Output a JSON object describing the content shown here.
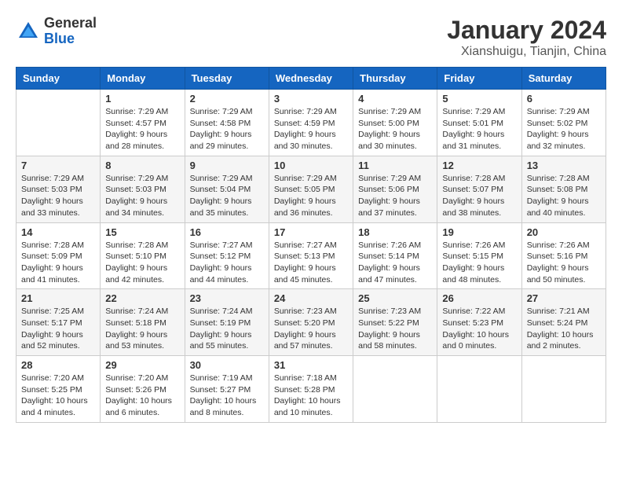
{
  "logo": {
    "general": "General",
    "blue": "Blue"
  },
  "header": {
    "title": "January 2024",
    "location": "Xianshuigu, Tianjin, China"
  },
  "weekdays": [
    "Sunday",
    "Monday",
    "Tuesday",
    "Wednesday",
    "Thursday",
    "Friday",
    "Saturday"
  ],
  "weeks": [
    [
      {
        "day": "",
        "info": ""
      },
      {
        "day": "1",
        "info": "Sunrise: 7:29 AM\nSunset: 4:57 PM\nDaylight: 9 hours\nand 28 minutes."
      },
      {
        "day": "2",
        "info": "Sunrise: 7:29 AM\nSunset: 4:58 PM\nDaylight: 9 hours\nand 29 minutes."
      },
      {
        "day": "3",
        "info": "Sunrise: 7:29 AM\nSunset: 4:59 PM\nDaylight: 9 hours\nand 30 minutes."
      },
      {
        "day": "4",
        "info": "Sunrise: 7:29 AM\nSunset: 5:00 PM\nDaylight: 9 hours\nand 30 minutes."
      },
      {
        "day": "5",
        "info": "Sunrise: 7:29 AM\nSunset: 5:01 PM\nDaylight: 9 hours\nand 31 minutes."
      },
      {
        "day": "6",
        "info": "Sunrise: 7:29 AM\nSunset: 5:02 PM\nDaylight: 9 hours\nand 32 minutes."
      }
    ],
    [
      {
        "day": "7",
        "info": "Sunrise: 7:29 AM\nSunset: 5:03 PM\nDaylight: 9 hours\nand 33 minutes."
      },
      {
        "day": "8",
        "info": "Sunrise: 7:29 AM\nSunset: 5:03 PM\nDaylight: 9 hours\nand 34 minutes."
      },
      {
        "day": "9",
        "info": "Sunrise: 7:29 AM\nSunset: 5:04 PM\nDaylight: 9 hours\nand 35 minutes."
      },
      {
        "day": "10",
        "info": "Sunrise: 7:29 AM\nSunset: 5:05 PM\nDaylight: 9 hours\nand 36 minutes."
      },
      {
        "day": "11",
        "info": "Sunrise: 7:29 AM\nSunset: 5:06 PM\nDaylight: 9 hours\nand 37 minutes."
      },
      {
        "day": "12",
        "info": "Sunrise: 7:28 AM\nSunset: 5:07 PM\nDaylight: 9 hours\nand 38 minutes."
      },
      {
        "day": "13",
        "info": "Sunrise: 7:28 AM\nSunset: 5:08 PM\nDaylight: 9 hours\nand 40 minutes."
      }
    ],
    [
      {
        "day": "14",
        "info": "Sunrise: 7:28 AM\nSunset: 5:09 PM\nDaylight: 9 hours\nand 41 minutes."
      },
      {
        "day": "15",
        "info": "Sunrise: 7:28 AM\nSunset: 5:10 PM\nDaylight: 9 hours\nand 42 minutes."
      },
      {
        "day": "16",
        "info": "Sunrise: 7:27 AM\nSunset: 5:12 PM\nDaylight: 9 hours\nand 44 minutes."
      },
      {
        "day": "17",
        "info": "Sunrise: 7:27 AM\nSunset: 5:13 PM\nDaylight: 9 hours\nand 45 minutes."
      },
      {
        "day": "18",
        "info": "Sunrise: 7:26 AM\nSunset: 5:14 PM\nDaylight: 9 hours\nand 47 minutes."
      },
      {
        "day": "19",
        "info": "Sunrise: 7:26 AM\nSunset: 5:15 PM\nDaylight: 9 hours\nand 48 minutes."
      },
      {
        "day": "20",
        "info": "Sunrise: 7:26 AM\nSunset: 5:16 PM\nDaylight: 9 hours\nand 50 minutes."
      }
    ],
    [
      {
        "day": "21",
        "info": "Sunrise: 7:25 AM\nSunset: 5:17 PM\nDaylight: 9 hours\nand 52 minutes."
      },
      {
        "day": "22",
        "info": "Sunrise: 7:24 AM\nSunset: 5:18 PM\nDaylight: 9 hours\nand 53 minutes."
      },
      {
        "day": "23",
        "info": "Sunrise: 7:24 AM\nSunset: 5:19 PM\nDaylight: 9 hours\nand 55 minutes."
      },
      {
        "day": "24",
        "info": "Sunrise: 7:23 AM\nSunset: 5:20 PM\nDaylight: 9 hours\nand 57 minutes."
      },
      {
        "day": "25",
        "info": "Sunrise: 7:23 AM\nSunset: 5:22 PM\nDaylight: 9 hours\nand 58 minutes."
      },
      {
        "day": "26",
        "info": "Sunrise: 7:22 AM\nSunset: 5:23 PM\nDaylight: 10 hours\nand 0 minutes."
      },
      {
        "day": "27",
        "info": "Sunrise: 7:21 AM\nSunset: 5:24 PM\nDaylight: 10 hours\nand 2 minutes."
      }
    ],
    [
      {
        "day": "28",
        "info": "Sunrise: 7:20 AM\nSunset: 5:25 PM\nDaylight: 10 hours\nand 4 minutes."
      },
      {
        "day": "29",
        "info": "Sunrise: 7:20 AM\nSunset: 5:26 PM\nDaylight: 10 hours\nand 6 minutes."
      },
      {
        "day": "30",
        "info": "Sunrise: 7:19 AM\nSunset: 5:27 PM\nDaylight: 10 hours\nand 8 minutes."
      },
      {
        "day": "31",
        "info": "Sunrise: 7:18 AM\nSunset: 5:28 PM\nDaylight: 10 hours\nand 10 minutes."
      },
      {
        "day": "",
        "info": ""
      },
      {
        "day": "",
        "info": ""
      },
      {
        "day": "",
        "info": ""
      }
    ]
  ]
}
